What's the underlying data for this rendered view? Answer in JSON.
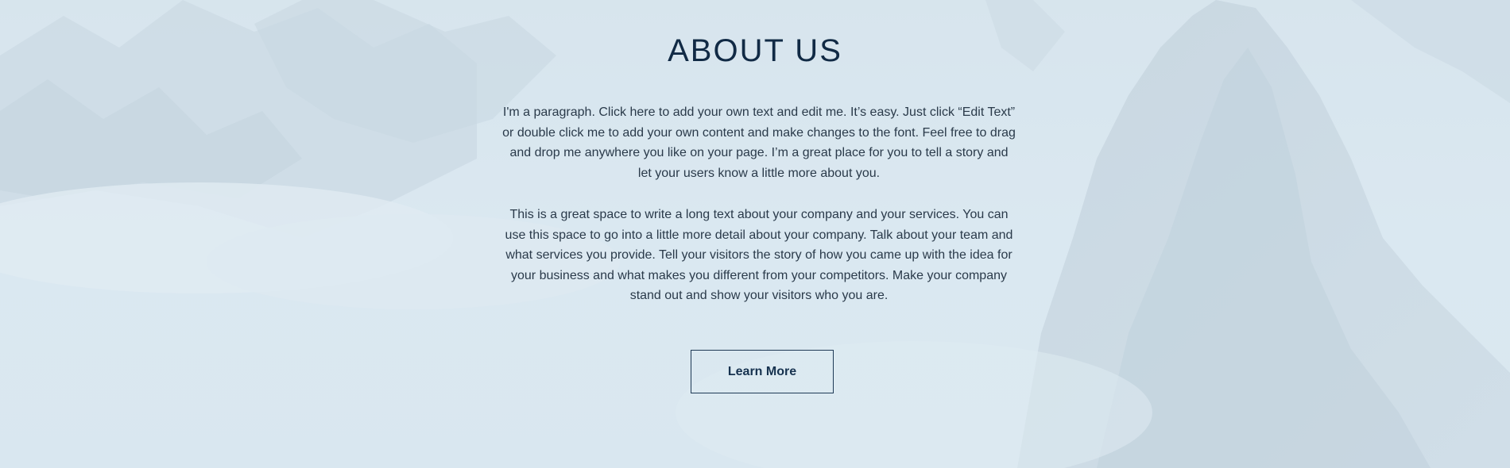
{
  "about": {
    "title": "ABOUT US",
    "paragraph_1": "I'm a paragraph. Click here to add your own text and edit me. It’s easy. Just click “Edit Text” or double click me to add your own content and make changes to the font. Feel free to drag and drop me anywhere you like on your page. I’m a great place for you to tell a story and let your users know a little more about you.",
    "paragraph_2": "This is a great space to write a long text about your company and your services. You can use this space to go into a little more detail about your company. Talk about your team and what services you provide. Tell your visitors the story of how you came up with the idea for your business and what makes you different from your competitors. Make your company stand out and show your visitors who you are.",
    "button_label": "Learn More"
  },
  "colors": {
    "background": "#dbe8f1",
    "title": "#112a45",
    "text": "#2a3a4a",
    "button_border": "#1f3a56"
  }
}
